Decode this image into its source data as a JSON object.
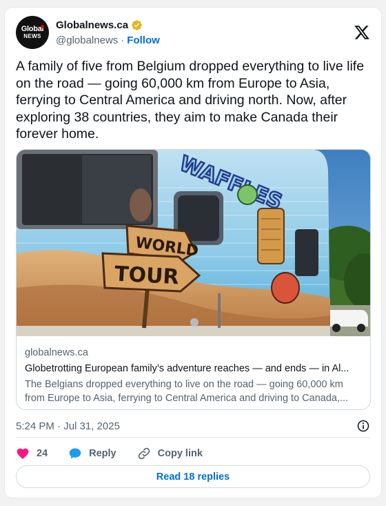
{
  "author": {
    "avatar_line1": "Global",
    "avatar_line2": "NEWS",
    "name": "Globalnews.ca",
    "handle": "@globalnews",
    "separator": "·",
    "follow_label": "Follow"
  },
  "tweet": {
    "text": "A family of five from Belgium dropped everything to live life on the road —  going 60,000 km from Europe to Asia, ferrying to Central America and driving north. Now, after exploring 38 countries, they aim to make Canada their forever home.",
    "timestamp": "5:24 PM · Jul 31, 2025"
  },
  "link_card": {
    "image_sign_text_1": "WORLD",
    "image_sign_text_2": "TOUR",
    "image_graffiti_text": "WAFFLES",
    "domain": "globalnews.ca",
    "title": "Globetrotting European family’s adventure reaches — and ends — in Al...",
    "description_line1": "The Belgians dropped everything to live on the road — going 60,000 km",
    "description_line2": "from Europe to Asia, ferrying to Central America and driving to Canada,..."
  },
  "actions": {
    "like_count": "24",
    "reply_label": "Reply",
    "copy_link_label": "Copy link",
    "read_replies_label": "Read 18 replies"
  },
  "icons": {
    "verified": "verified-badge-icon",
    "x_logo": "x-logo-icon",
    "info": "info-icon",
    "heart": "heart-icon",
    "reply": "reply-bubble-icon",
    "link": "link-icon"
  },
  "colors": {
    "accent_blue": "#006fd6",
    "heart_pink": "#f91880",
    "reply_blue": "#1d9bf0",
    "verified_gold": "#e2b719",
    "text_secondary": "#536471"
  }
}
